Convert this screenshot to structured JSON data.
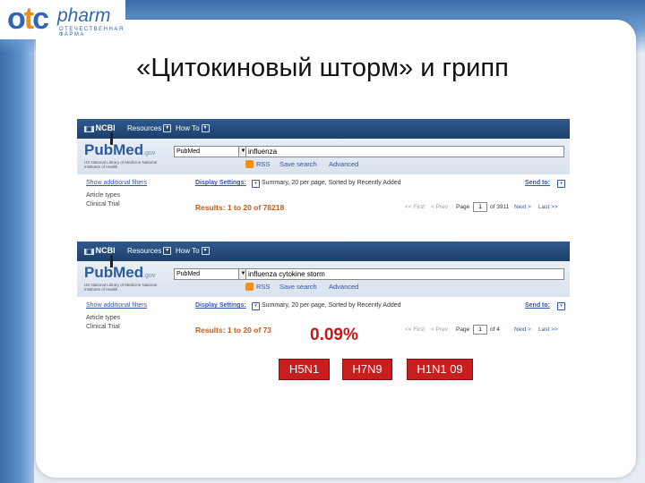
{
  "slide": {
    "title": "«Цитокиновый шторм» и грипп",
    "logo": {
      "mark": "otc",
      "name": "pharm",
      "tagline": "ОТЕЧЕСТВЕННАЯ ФАРМА"
    }
  },
  "pubmed_header": {
    "ncbi": "NCBI",
    "resources": "Resources",
    "how_to": "How To",
    "pubmed_logo_pub": "Pub",
    "pubmed_logo_med": "Med",
    "pubmed_logo_gov": ".gov",
    "subtitle": "US National Library of Medicine National Institutes of Health",
    "database": "PubMed",
    "rss": "RSS",
    "save_search": "Save search",
    "advanced": "Advanced"
  },
  "pubmed_body": {
    "show_filters": "Show additional filters",
    "article_types": "Article types",
    "clinical_trial": "Clinical Trial",
    "display_settings": "Display Settings:",
    "summary": "Summary, 20 per page, Sorted by Recently Added",
    "send_to": "Send to:",
    "first": "<< First",
    "prev": "< Prev",
    "page_label": "Page",
    "next": "Next >",
    "last": "Last >>"
  },
  "search1": {
    "query": "influenza",
    "results": "Results: 1 to 20 of 78218",
    "page": "1",
    "of_pages": "of 3911"
  },
  "search2": {
    "query": "influenza cytokine storm",
    "results": "Results: 1 to 20 of 73",
    "page": "1",
    "of_pages": "of 4"
  },
  "highlight": {
    "percent": "0.09%",
    "strains": [
      "H5N1",
      "H7N9",
      "H1N1 09"
    ]
  },
  "colors": {
    "accent_red": "#c81e1e",
    "results_orange": "#c65a17",
    "ncbi_blue": "#1d3f6c"
  }
}
